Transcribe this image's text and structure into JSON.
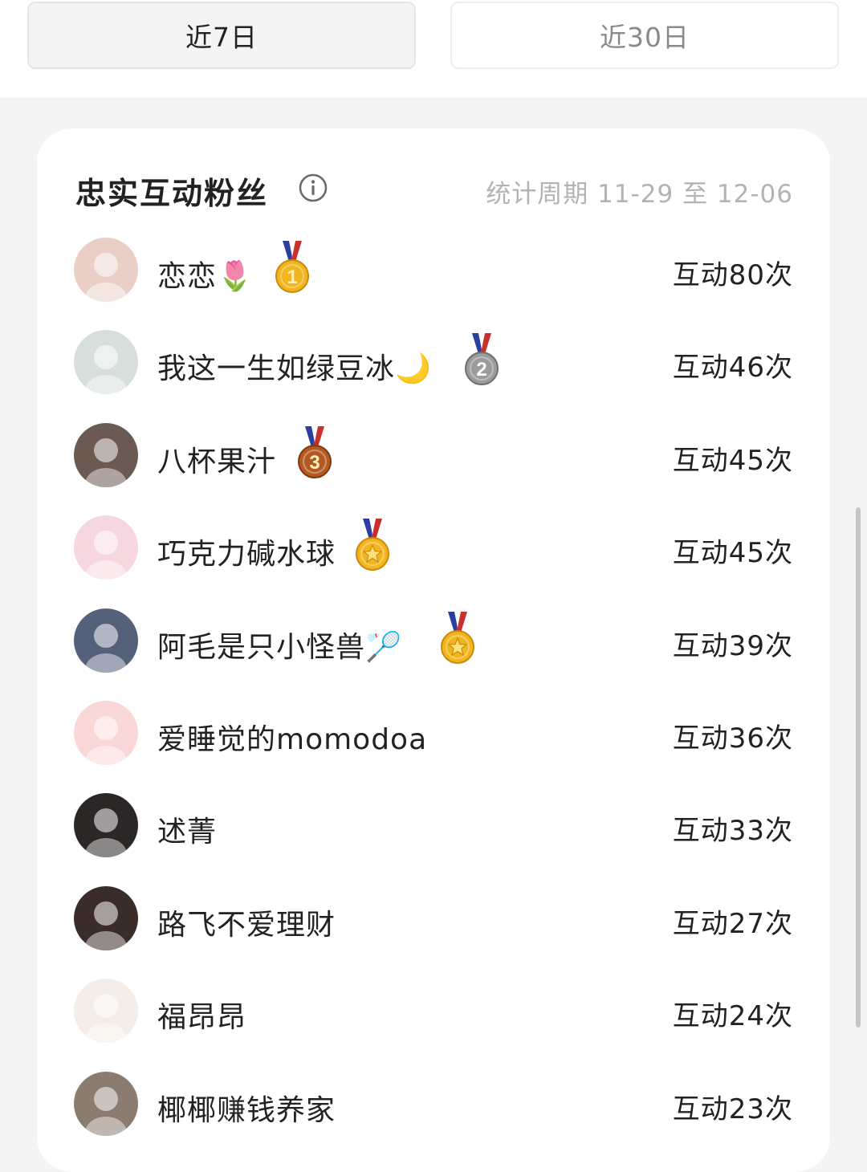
{
  "tabs": {
    "recent7": "近7日",
    "recent30": "近30日"
  },
  "card": {
    "title": "忠实互动粉丝",
    "info_icon": "info-icon",
    "period": "统计周期 11-29 至 12-06"
  },
  "fans": [
    {
      "name": "恋恋🌷",
      "count": "互动80次",
      "medal": "gold-1",
      "avatar_color": "#e9cfc6"
    },
    {
      "name": "我这一生如绿豆冰🌙",
      "count": "互动46次",
      "medal": "silver-2",
      "avatar_color": "#d7dfdc"
    },
    {
      "name": "八杯果汁",
      "count": "互动45次",
      "medal": "bronze-3",
      "avatar_color": "#6a5a52"
    },
    {
      "name": "巧克力碱水球",
      "count": "互动45次",
      "medal": "gold-star",
      "avatar_color": "#f6d7df"
    },
    {
      "name": "阿毛是只小怪兽🏸",
      "count": "互动39次",
      "medal": "gold-star",
      "avatar_color": "#55607a"
    },
    {
      "name": "爱睡觉的momodoa",
      "count": "互动36次",
      "medal": "",
      "avatar_color": "#fbd8d8"
    },
    {
      "name": "述菁",
      "count": "互动33次",
      "medal": "",
      "avatar_color": "#2b2726"
    },
    {
      "name": "路飞不爱理财",
      "count": "互动27次",
      "medal": "",
      "avatar_color": "#3a2c28"
    },
    {
      "name": "福昂昂",
      "count": "互动24次",
      "medal": "",
      "avatar_color": "#f5eee8"
    },
    {
      "name": "椰椰赚钱养家",
      "count": "互动23次",
      "medal": "",
      "avatar_color": "#8a7d70"
    }
  ]
}
